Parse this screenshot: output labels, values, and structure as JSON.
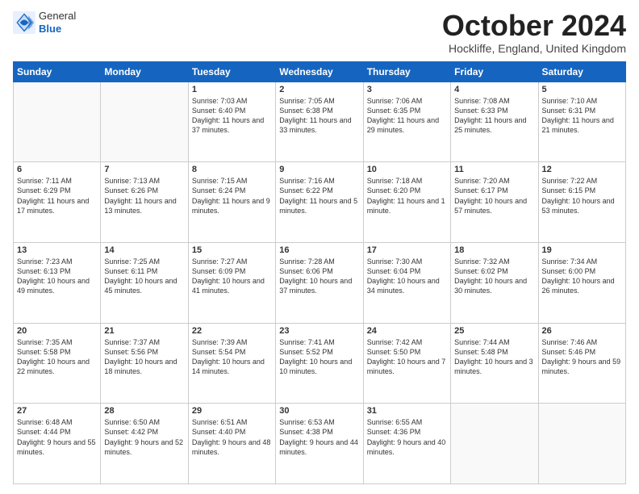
{
  "header": {
    "logo_general": "General",
    "logo_blue": "Blue",
    "month_title": "October 2024",
    "location": "Hockliffe, England, United Kingdom"
  },
  "days_of_week": [
    "Sunday",
    "Monday",
    "Tuesday",
    "Wednesday",
    "Thursday",
    "Friday",
    "Saturday"
  ],
  "weeks": [
    [
      {
        "day": "",
        "info": ""
      },
      {
        "day": "",
        "info": ""
      },
      {
        "day": "1",
        "info": "Sunrise: 7:03 AM\nSunset: 6:40 PM\nDaylight: 11 hours and 37 minutes."
      },
      {
        "day": "2",
        "info": "Sunrise: 7:05 AM\nSunset: 6:38 PM\nDaylight: 11 hours and 33 minutes."
      },
      {
        "day": "3",
        "info": "Sunrise: 7:06 AM\nSunset: 6:35 PM\nDaylight: 11 hours and 29 minutes."
      },
      {
        "day": "4",
        "info": "Sunrise: 7:08 AM\nSunset: 6:33 PM\nDaylight: 11 hours and 25 minutes."
      },
      {
        "day": "5",
        "info": "Sunrise: 7:10 AM\nSunset: 6:31 PM\nDaylight: 11 hours and 21 minutes."
      }
    ],
    [
      {
        "day": "6",
        "info": "Sunrise: 7:11 AM\nSunset: 6:29 PM\nDaylight: 11 hours and 17 minutes."
      },
      {
        "day": "7",
        "info": "Sunrise: 7:13 AM\nSunset: 6:26 PM\nDaylight: 11 hours and 13 minutes."
      },
      {
        "day": "8",
        "info": "Sunrise: 7:15 AM\nSunset: 6:24 PM\nDaylight: 11 hours and 9 minutes."
      },
      {
        "day": "9",
        "info": "Sunrise: 7:16 AM\nSunset: 6:22 PM\nDaylight: 11 hours and 5 minutes."
      },
      {
        "day": "10",
        "info": "Sunrise: 7:18 AM\nSunset: 6:20 PM\nDaylight: 11 hours and 1 minute."
      },
      {
        "day": "11",
        "info": "Sunrise: 7:20 AM\nSunset: 6:17 PM\nDaylight: 10 hours and 57 minutes."
      },
      {
        "day": "12",
        "info": "Sunrise: 7:22 AM\nSunset: 6:15 PM\nDaylight: 10 hours and 53 minutes."
      }
    ],
    [
      {
        "day": "13",
        "info": "Sunrise: 7:23 AM\nSunset: 6:13 PM\nDaylight: 10 hours and 49 minutes."
      },
      {
        "day": "14",
        "info": "Sunrise: 7:25 AM\nSunset: 6:11 PM\nDaylight: 10 hours and 45 minutes."
      },
      {
        "day": "15",
        "info": "Sunrise: 7:27 AM\nSunset: 6:09 PM\nDaylight: 10 hours and 41 minutes."
      },
      {
        "day": "16",
        "info": "Sunrise: 7:28 AM\nSunset: 6:06 PM\nDaylight: 10 hours and 37 minutes."
      },
      {
        "day": "17",
        "info": "Sunrise: 7:30 AM\nSunset: 6:04 PM\nDaylight: 10 hours and 34 minutes."
      },
      {
        "day": "18",
        "info": "Sunrise: 7:32 AM\nSunset: 6:02 PM\nDaylight: 10 hours and 30 minutes."
      },
      {
        "day": "19",
        "info": "Sunrise: 7:34 AM\nSunset: 6:00 PM\nDaylight: 10 hours and 26 minutes."
      }
    ],
    [
      {
        "day": "20",
        "info": "Sunrise: 7:35 AM\nSunset: 5:58 PM\nDaylight: 10 hours and 22 minutes."
      },
      {
        "day": "21",
        "info": "Sunrise: 7:37 AM\nSunset: 5:56 PM\nDaylight: 10 hours and 18 minutes."
      },
      {
        "day": "22",
        "info": "Sunrise: 7:39 AM\nSunset: 5:54 PM\nDaylight: 10 hours and 14 minutes."
      },
      {
        "day": "23",
        "info": "Sunrise: 7:41 AM\nSunset: 5:52 PM\nDaylight: 10 hours and 10 minutes."
      },
      {
        "day": "24",
        "info": "Sunrise: 7:42 AM\nSunset: 5:50 PM\nDaylight: 10 hours and 7 minutes."
      },
      {
        "day": "25",
        "info": "Sunrise: 7:44 AM\nSunset: 5:48 PM\nDaylight: 10 hours and 3 minutes."
      },
      {
        "day": "26",
        "info": "Sunrise: 7:46 AM\nSunset: 5:46 PM\nDaylight: 9 hours and 59 minutes."
      }
    ],
    [
      {
        "day": "27",
        "info": "Sunrise: 6:48 AM\nSunset: 4:44 PM\nDaylight: 9 hours and 55 minutes."
      },
      {
        "day": "28",
        "info": "Sunrise: 6:50 AM\nSunset: 4:42 PM\nDaylight: 9 hours and 52 minutes."
      },
      {
        "day": "29",
        "info": "Sunrise: 6:51 AM\nSunset: 4:40 PM\nDaylight: 9 hours and 48 minutes."
      },
      {
        "day": "30",
        "info": "Sunrise: 6:53 AM\nSunset: 4:38 PM\nDaylight: 9 hours and 44 minutes."
      },
      {
        "day": "31",
        "info": "Sunrise: 6:55 AM\nSunset: 4:36 PM\nDaylight: 9 hours and 40 minutes."
      },
      {
        "day": "",
        "info": ""
      },
      {
        "day": "",
        "info": ""
      }
    ]
  ]
}
